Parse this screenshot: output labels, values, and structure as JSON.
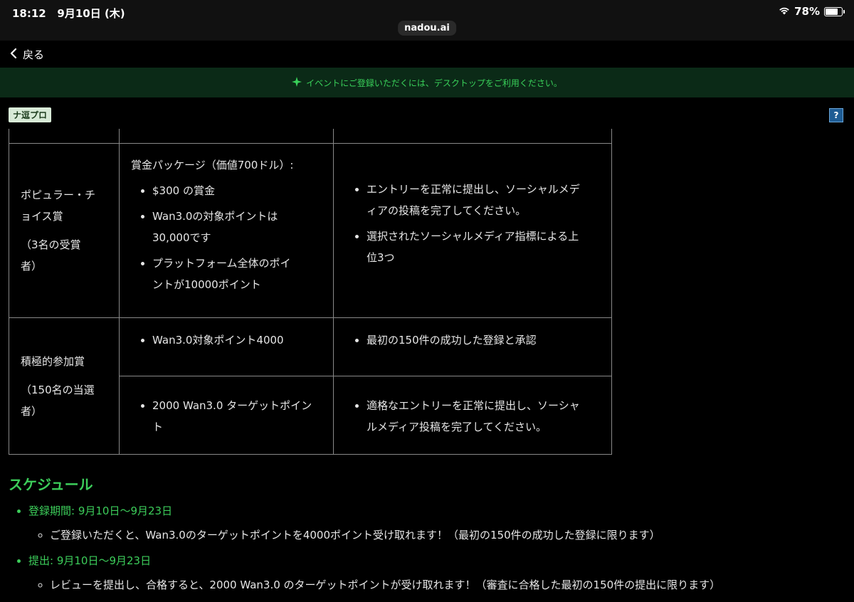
{
  "status": {
    "time": "18:12",
    "date": "9月10日 (木)",
    "battery": "78%",
    "url": "nadou.ai"
  },
  "nav": {
    "back_label": "戻る"
  },
  "banner": {
    "text": "イベントにご登録いただくには、デスクトップをご利用ください。"
  },
  "tag": "ナ逗プロ",
  "help": "?",
  "table": {
    "popular": {
      "name_lines": [
        "ポピュラー・チ",
        "ョイス賞"
      ],
      "count_lines": [
        "（3名の受賞",
        "者）"
      ],
      "prize_heading": "賞金パッケージ（価値700ドル）:",
      "prizes": [
        [
          "$300 の賞金"
        ],
        [
          "Wan3.0の対象ポイントは",
          "30,000です"
        ],
        [
          "プラットフォーム全体のポイ",
          "ントが10000ポイント"
        ]
      ],
      "criteria": [
        [
          "エントリーを正常に提出し、ソーシャルメデ",
          "ィアの投稿を完了してください。"
        ],
        [
          "選択されたソーシャルメディア指標による上",
          "位3つ"
        ]
      ]
    },
    "active": {
      "name": "積極的参加賞",
      "count_lines": [
        "（150名の当選",
        "者）"
      ],
      "row1_prize": "Wan3.0対象ポイント4000",
      "row1_criteria": "最初の150件の成功した登録と承認",
      "row2_prize": [
        "2000 Wan3.0 ターゲットポイン",
        "ト"
      ],
      "row2_criteria": [
        "適格なエントリーを正常に提出し、ソーシャ",
        "ルメディア投稿を完了してください。"
      ]
    }
  },
  "schedule": {
    "title": "スケジュール",
    "items": [
      {
        "label": "登録期間: 9月10日〜9月23日",
        "sub": "ご登録いただくと、Wan3.0のターゲットポイントを4000ポイント受け取れます！（最初の150件の成功した登録に限ります）"
      },
      {
        "label": "提出: 9月10日〜9月23日",
        "sub": "レビューを提出し、合格すると、2000 Wan3.0 のターゲットポイントが受け取れます！（審査に合格した最初の150件の提出に限ります）"
      }
    ]
  }
}
